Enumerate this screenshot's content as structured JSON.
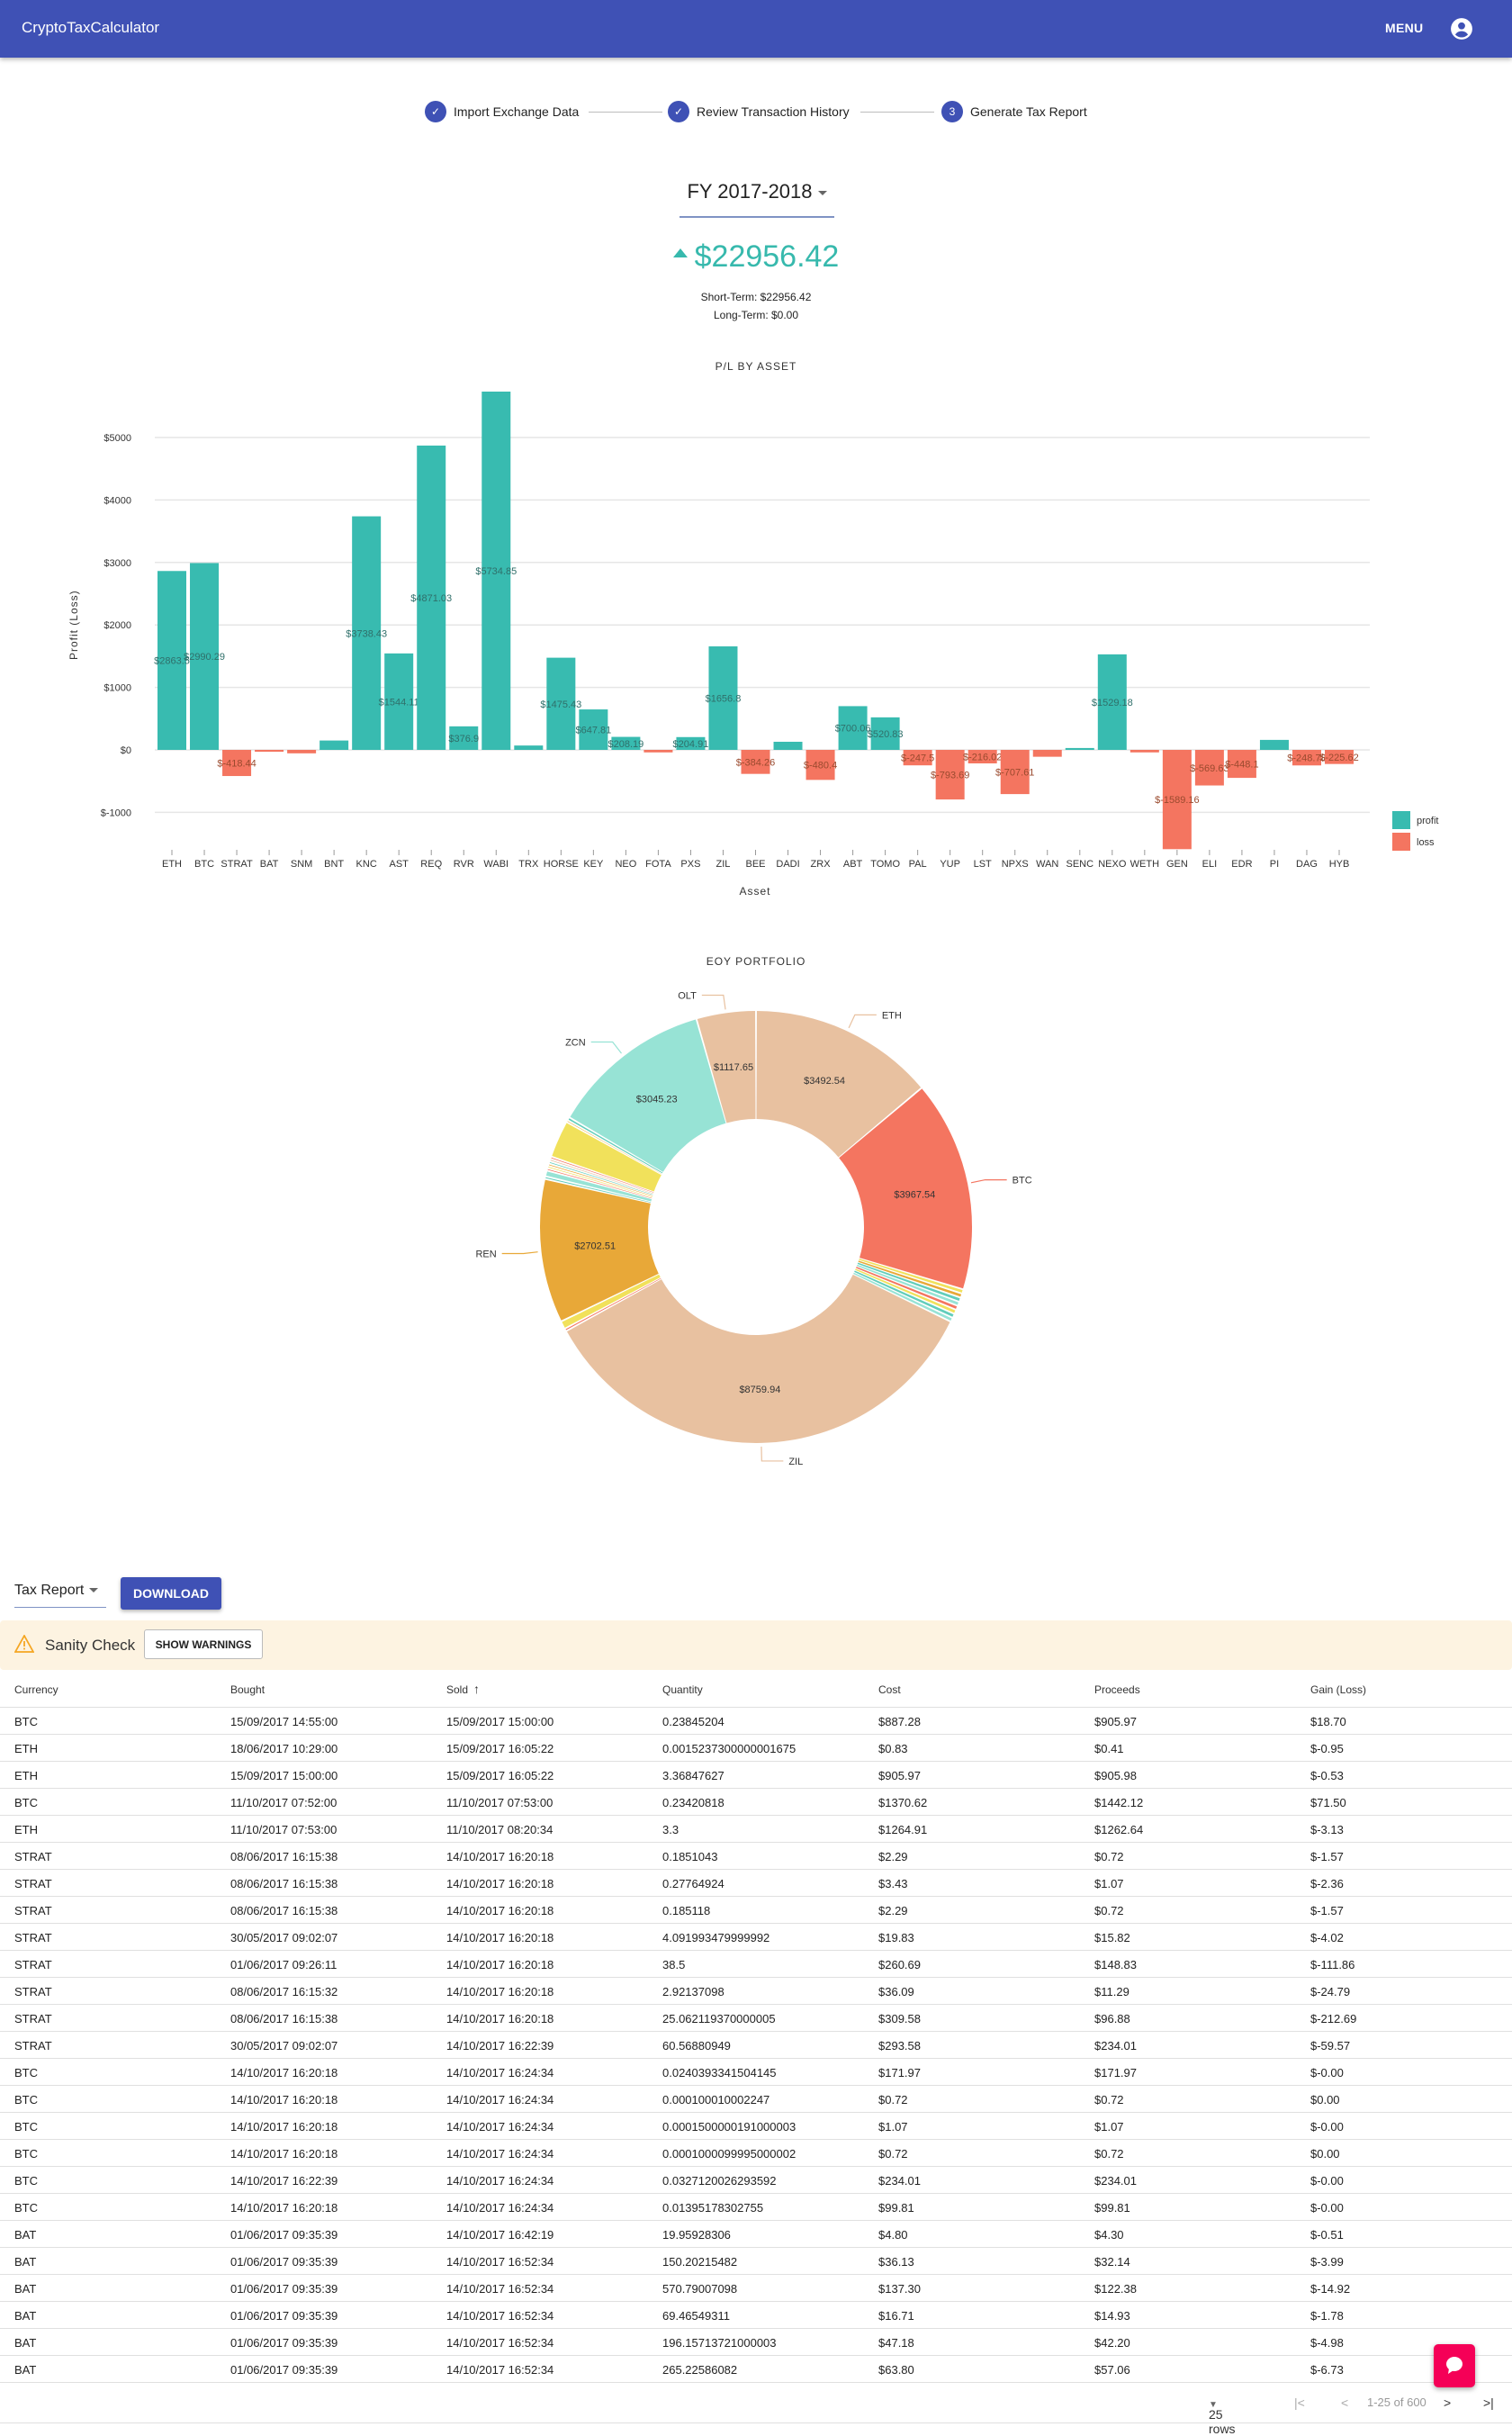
{
  "app": {
    "title": "CryptoTaxCalculator",
    "menu_label": "MENU",
    "account_icon": "account-circle-icon",
    "brand_color": "#3f51b5"
  },
  "stepper": [
    {
      "label": "Import Exchange Data",
      "state": "done",
      "icon": "check-icon"
    },
    {
      "label": "Review Transaction History",
      "state": "done",
      "icon": "check-icon"
    },
    {
      "label": "Generate Tax Report",
      "state": "active",
      "number": "3"
    }
  ],
  "summary": {
    "fiscal_year": "FY 2017-2018",
    "total": "$22956.42",
    "trend": "up",
    "short_term": "Short-Term: $22956.42",
    "long_term": "Long-Term: $0.00"
  },
  "chart_data": [
    {
      "type": "bar",
      "title": "P/L BY ASSET",
      "xlabel": "Asset",
      "ylabel": "Profit (Loss)",
      "ylim": [
        -1600,
        5750
      ],
      "yticks": [
        -1000,
        0,
        1000,
        2000,
        3000,
        4000,
        5000
      ],
      "ytick_labels": [
        "$-1000",
        "$0",
        "$1000",
        "$2000",
        "$3000",
        "$4000",
        "$5000"
      ],
      "grid": true,
      "legend": {
        "placement": "bottom-right",
        "entries": [
          {
            "name": "profit",
            "color": "#38bbb0"
          },
          {
            "name": "loss",
            "color": "#f47560"
          }
        ]
      },
      "categories": [
        "ETH",
        "BTC",
        "STRAT",
        "BAT",
        "SNM",
        "BNT",
        "KNC",
        "AST",
        "REQ",
        "RVR",
        "WABI",
        "TRX",
        "HORSE",
        "KEY",
        "NEO",
        "FOTA",
        "PXS",
        "ZIL",
        "BEE",
        "DADI",
        "ZRX",
        "ABT",
        "TOMO",
        "PAL",
        "YUP",
        "LST",
        "NPXS",
        "WAN",
        "SENC",
        "NEXO",
        "WETH",
        "GEN",
        "ELI",
        "EDR",
        "PI",
        "DAG",
        "HYB"
      ],
      "values": [
        2863.5,
        2990.29,
        -418.44,
        -30,
        -55,
        150,
        3738.43,
        1544.11,
        4871.03,
        376.9,
        5734.85,
        70,
        1475.43,
        647.81,
        208.19,
        -40,
        204.91,
        1656.8,
        -384.26,
        130,
        -480.4,
        700.06,
        520.83,
        -247.5,
        -793.69,
        -216.02,
        -707.61,
        -110,
        30,
        1529.18,
        -40,
        -1589.16,
        -569.63,
        -448.1,
        160,
        -248.78,
        -225.62
      ],
      "labels": [
        "$2863.5",
        "$2990.29",
        "$-418.44",
        "",
        "",
        "",
        "$3738.43",
        "$1544.11",
        "$4871.03",
        "$376.9",
        "$5734.85",
        "",
        "$1475.43",
        "$647.81",
        "$208.19",
        "",
        "$204.91",
        "$1656.8",
        "$-384.26",
        "",
        "$-480.4",
        "$700.06",
        "$520.83",
        "$-247.5",
        "$-793.69",
        "$-216.02",
        "$-707.61",
        "",
        "",
        "$1529.18",
        "",
        "$-1589.16",
        "$-569.63",
        "$-448.1",
        "",
        "$-248.78",
        "$-225.62"
      ]
    },
    {
      "type": "pie",
      "title": "EOY PORTFOLIO",
      "donut": true,
      "slices": [
        {
          "name": "ETH",
          "value": 3492.54,
          "label": "$3492.54",
          "color": "#e8c1a0"
        },
        {
          "name": "BTC",
          "value": 3967.54,
          "label": "$3967.54",
          "color": "#f47560"
        },
        {
          "name": "",
          "value": 80,
          "label": "",
          "color": "#f1e15b"
        },
        {
          "name": "",
          "value": 80,
          "label": "",
          "color": "#e8a838"
        },
        {
          "name": "",
          "value": 80,
          "label": "",
          "color": "#61cdbb"
        },
        {
          "name": "",
          "value": 80,
          "label": "",
          "color": "#97e3d5"
        },
        {
          "name": "",
          "value": 80,
          "label": "",
          "color": "#f47560"
        },
        {
          "name": "",
          "value": 80,
          "label": "",
          "color": "#f1e15b"
        },
        {
          "name": "",
          "value": 80,
          "label": "",
          "color": "#61cdbb"
        },
        {
          "name": "",
          "value": 80,
          "label": "",
          "color": "#97e3d5"
        },
        {
          "name": "ZIL",
          "value": 8759.94,
          "label": "$8759.94",
          "color": "#e8c1a0"
        },
        {
          "name": "",
          "value": 50,
          "label": "",
          "color": "#f47560"
        },
        {
          "name": "",
          "value": 150,
          "label": "",
          "color": "#f1e15b"
        },
        {
          "name": "REN",
          "value": 2702.51,
          "label": "$2702.51",
          "color": "#e8a838"
        },
        {
          "name": "",
          "value": 50,
          "label": "",
          "color": "#61cdbb"
        },
        {
          "name": "",
          "value": 110,
          "label": "",
          "color": "#97e3d5"
        },
        {
          "name": "",
          "value": 45,
          "label": "",
          "color": "#f47560"
        },
        {
          "name": "",
          "value": 45,
          "label": "",
          "color": "#f1e15b"
        },
        {
          "name": "",
          "value": 45,
          "label": "",
          "color": "#e8a838"
        },
        {
          "name": "",
          "value": 45,
          "label": "",
          "color": "#61cdbb"
        },
        {
          "name": "",
          "value": 45,
          "label": "",
          "color": "#e8c1a0"
        },
        {
          "name": "",
          "value": 45,
          "label": "",
          "color": "#f47560"
        },
        {
          "name": "",
          "value": 700,
          "label": "",
          "color": "#f1e15b"
        },
        {
          "name": "",
          "value": 40,
          "label": "",
          "color": "#e8a838"
        },
        {
          "name": "",
          "value": 60,
          "label": "",
          "color": "#61cdbb"
        },
        {
          "name": "ZCN",
          "value": 3045.23,
          "label": "$3045.23",
          "color": "#97e3d5"
        },
        {
          "name": "OLT",
          "value": 1117.65,
          "label": "$1117.65",
          "color": "#e8c1a0"
        }
      ]
    }
  ],
  "report": {
    "report_type": "Tax Report",
    "download_label": "DOWNLOAD",
    "sanity_label": "Sanity Check",
    "show_warnings_label": "SHOW WARNINGS",
    "warning_color": "#f5a623",
    "columns": [
      "Currency",
      "Bought",
      "Sold",
      "Quantity",
      "Cost",
      "Proceeds",
      "Gain (Loss)"
    ],
    "sort_column": "Sold",
    "sort_dir": "asc",
    "rows": [
      [
        "BTC",
        "15/09/2017 14:55:00",
        "15/09/2017 15:00:00",
        "0.23845204",
        "$887.28",
        "$905.97",
        "$18.70"
      ],
      [
        "ETH",
        "18/06/2017 10:29:00",
        "15/09/2017 16:05:22",
        "0.0015237300000001675",
        "$0.83",
        "$0.41",
        "$-0.95"
      ],
      [
        "ETH",
        "15/09/2017 15:00:00",
        "15/09/2017 16:05:22",
        "3.36847627",
        "$905.97",
        "$905.98",
        "$-0.53"
      ],
      [
        "BTC",
        "11/10/2017 07:52:00",
        "11/10/2017 07:53:00",
        "0.23420818",
        "$1370.62",
        "$1442.12",
        "$71.50"
      ],
      [
        "ETH",
        "11/10/2017 07:53:00",
        "11/10/2017 08:20:34",
        "3.3",
        "$1264.91",
        "$1262.64",
        "$-3.13"
      ],
      [
        "STRAT",
        "08/06/2017 16:15:38",
        "14/10/2017 16:20:18",
        "0.1851043",
        "$2.29",
        "$0.72",
        "$-1.57"
      ],
      [
        "STRAT",
        "08/06/2017 16:15:38",
        "14/10/2017 16:20:18",
        "0.27764924",
        "$3.43",
        "$1.07",
        "$-2.36"
      ],
      [
        "STRAT",
        "08/06/2017 16:15:38",
        "14/10/2017 16:20:18",
        "0.185118",
        "$2.29",
        "$0.72",
        "$-1.57"
      ],
      [
        "STRAT",
        "30/05/2017 09:02:07",
        "14/10/2017 16:20:18",
        "4.091993479999992",
        "$19.83",
        "$15.82",
        "$-4.02"
      ],
      [
        "STRAT",
        "01/06/2017 09:26:11",
        "14/10/2017 16:20:18",
        "38.5",
        "$260.69",
        "$148.83",
        "$-111.86"
      ],
      [
        "STRAT",
        "08/06/2017 16:15:32",
        "14/10/2017 16:20:18",
        "2.92137098",
        "$36.09",
        "$11.29",
        "$-24.79"
      ],
      [
        "STRAT",
        "08/06/2017 16:15:38",
        "14/10/2017 16:20:18",
        "25.062119370000005",
        "$309.58",
        "$96.88",
        "$-212.69"
      ],
      [
        "STRAT",
        "30/05/2017 09:02:07",
        "14/10/2017 16:22:39",
        "60.56880949",
        "$293.58",
        "$234.01",
        "$-59.57"
      ],
      [
        "BTC",
        "14/10/2017 16:20:18",
        "14/10/2017 16:24:34",
        "0.0240393341504145",
        "$171.97",
        "$171.97",
        "$-0.00"
      ],
      [
        "BTC",
        "14/10/2017 16:20:18",
        "14/10/2017 16:24:34",
        "0.000100010002247",
        "$0.72",
        "$0.72",
        "$0.00"
      ],
      [
        "BTC",
        "14/10/2017 16:20:18",
        "14/10/2017 16:24:34",
        "0.0001500000191000003",
        "$1.07",
        "$1.07",
        "$-0.00"
      ],
      [
        "BTC",
        "14/10/2017 16:20:18",
        "14/10/2017 16:24:34",
        "0.0001000099995000002",
        "$0.72",
        "$0.72",
        "$0.00"
      ],
      [
        "BTC",
        "14/10/2017 16:22:39",
        "14/10/2017 16:24:34",
        "0.0327120026293592",
        "$234.01",
        "$234.01",
        "$-0.00"
      ],
      [
        "BTC",
        "14/10/2017 16:20:18",
        "14/10/2017 16:24:34",
        "0.01395178302755",
        "$99.81",
        "$99.81",
        "$-0.00"
      ],
      [
        "BAT",
        "01/06/2017 09:35:39",
        "14/10/2017 16:42:19",
        "19.95928306",
        "$4.80",
        "$4.30",
        "$-0.51"
      ],
      [
        "BAT",
        "01/06/2017 09:35:39",
        "14/10/2017 16:52:34",
        "150.20215482",
        "$36.13",
        "$32.14",
        "$-3.99"
      ],
      [
        "BAT",
        "01/06/2017 09:35:39",
        "14/10/2017 16:52:34",
        "570.79007098",
        "$137.30",
        "$122.38",
        "$-14.92"
      ],
      [
        "BAT",
        "01/06/2017 09:35:39",
        "14/10/2017 16:52:34",
        "69.46549311",
        "$16.71",
        "$14.93",
        "$-1.78"
      ],
      [
        "BAT",
        "01/06/2017 09:35:39",
        "14/10/2017 16:52:34",
        "196.15713721000003",
        "$47.18",
        "$42.20",
        "$-4.98"
      ],
      [
        "BAT",
        "01/06/2017 09:35:39",
        "14/10/2017 16:52:34",
        "265.22586082",
        "$63.80",
        "$57.06",
        "$-6.73"
      ]
    ],
    "pagination": {
      "rows_per_page": "25 rows",
      "range": "1-25 of 600"
    }
  },
  "chat_button_color": "#f50057"
}
